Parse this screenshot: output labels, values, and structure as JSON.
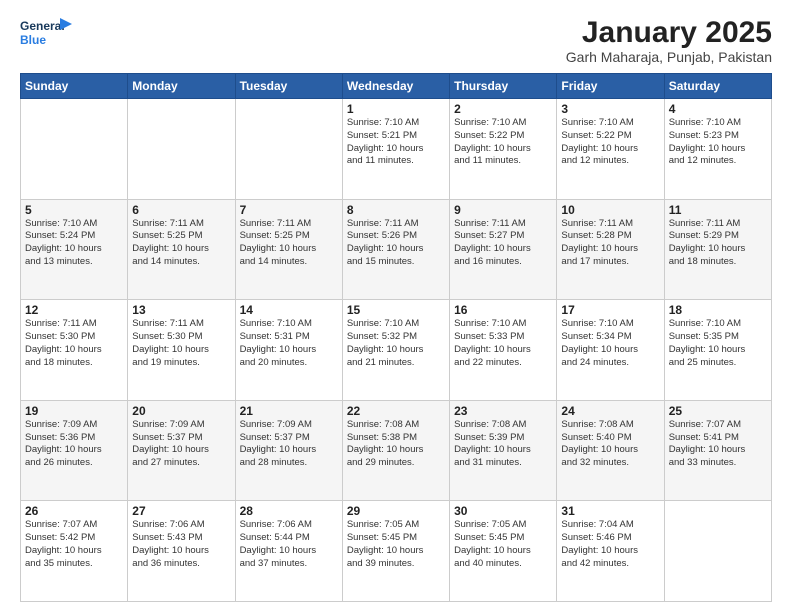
{
  "header": {
    "logo_line1": "General",
    "logo_line2": "Blue",
    "title": "January 2025",
    "subtitle": "Garh Maharaja, Punjab, Pakistan"
  },
  "columns": [
    "Sunday",
    "Monday",
    "Tuesday",
    "Wednesday",
    "Thursday",
    "Friday",
    "Saturday"
  ],
  "weeks": [
    [
      {
        "day": "",
        "info": ""
      },
      {
        "day": "",
        "info": ""
      },
      {
        "day": "",
        "info": ""
      },
      {
        "day": "1",
        "info": "Sunrise: 7:10 AM\nSunset: 5:21 PM\nDaylight: 10 hours\nand 11 minutes."
      },
      {
        "day": "2",
        "info": "Sunrise: 7:10 AM\nSunset: 5:22 PM\nDaylight: 10 hours\nand 11 minutes."
      },
      {
        "day": "3",
        "info": "Sunrise: 7:10 AM\nSunset: 5:22 PM\nDaylight: 10 hours\nand 12 minutes."
      },
      {
        "day": "4",
        "info": "Sunrise: 7:10 AM\nSunset: 5:23 PM\nDaylight: 10 hours\nand 12 minutes."
      }
    ],
    [
      {
        "day": "5",
        "info": "Sunrise: 7:10 AM\nSunset: 5:24 PM\nDaylight: 10 hours\nand 13 minutes."
      },
      {
        "day": "6",
        "info": "Sunrise: 7:11 AM\nSunset: 5:25 PM\nDaylight: 10 hours\nand 14 minutes."
      },
      {
        "day": "7",
        "info": "Sunrise: 7:11 AM\nSunset: 5:25 PM\nDaylight: 10 hours\nand 14 minutes."
      },
      {
        "day": "8",
        "info": "Sunrise: 7:11 AM\nSunset: 5:26 PM\nDaylight: 10 hours\nand 15 minutes."
      },
      {
        "day": "9",
        "info": "Sunrise: 7:11 AM\nSunset: 5:27 PM\nDaylight: 10 hours\nand 16 minutes."
      },
      {
        "day": "10",
        "info": "Sunrise: 7:11 AM\nSunset: 5:28 PM\nDaylight: 10 hours\nand 17 minutes."
      },
      {
        "day": "11",
        "info": "Sunrise: 7:11 AM\nSunset: 5:29 PM\nDaylight: 10 hours\nand 18 minutes."
      }
    ],
    [
      {
        "day": "12",
        "info": "Sunrise: 7:11 AM\nSunset: 5:30 PM\nDaylight: 10 hours\nand 18 minutes."
      },
      {
        "day": "13",
        "info": "Sunrise: 7:11 AM\nSunset: 5:30 PM\nDaylight: 10 hours\nand 19 minutes."
      },
      {
        "day": "14",
        "info": "Sunrise: 7:10 AM\nSunset: 5:31 PM\nDaylight: 10 hours\nand 20 minutes."
      },
      {
        "day": "15",
        "info": "Sunrise: 7:10 AM\nSunset: 5:32 PM\nDaylight: 10 hours\nand 21 minutes."
      },
      {
        "day": "16",
        "info": "Sunrise: 7:10 AM\nSunset: 5:33 PM\nDaylight: 10 hours\nand 22 minutes."
      },
      {
        "day": "17",
        "info": "Sunrise: 7:10 AM\nSunset: 5:34 PM\nDaylight: 10 hours\nand 24 minutes."
      },
      {
        "day": "18",
        "info": "Sunrise: 7:10 AM\nSunset: 5:35 PM\nDaylight: 10 hours\nand 25 minutes."
      }
    ],
    [
      {
        "day": "19",
        "info": "Sunrise: 7:09 AM\nSunset: 5:36 PM\nDaylight: 10 hours\nand 26 minutes."
      },
      {
        "day": "20",
        "info": "Sunrise: 7:09 AM\nSunset: 5:37 PM\nDaylight: 10 hours\nand 27 minutes."
      },
      {
        "day": "21",
        "info": "Sunrise: 7:09 AM\nSunset: 5:37 PM\nDaylight: 10 hours\nand 28 minutes."
      },
      {
        "day": "22",
        "info": "Sunrise: 7:08 AM\nSunset: 5:38 PM\nDaylight: 10 hours\nand 29 minutes."
      },
      {
        "day": "23",
        "info": "Sunrise: 7:08 AM\nSunset: 5:39 PM\nDaylight: 10 hours\nand 31 minutes."
      },
      {
        "day": "24",
        "info": "Sunrise: 7:08 AM\nSunset: 5:40 PM\nDaylight: 10 hours\nand 32 minutes."
      },
      {
        "day": "25",
        "info": "Sunrise: 7:07 AM\nSunset: 5:41 PM\nDaylight: 10 hours\nand 33 minutes."
      }
    ],
    [
      {
        "day": "26",
        "info": "Sunrise: 7:07 AM\nSunset: 5:42 PM\nDaylight: 10 hours\nand 35 minutes."
      },
      {
        "day": "27",
        "info": "Sunrise: 7:06 AM\nSunset: 5:43 PM\nDaylight: 10 hours\nand 36 minutes."
      },
      {
        "day": "28",
        "info": "Sunrise: 7:06 AM\nSunset: 5:44 PM\nDaylight: 10 hours\nand 37 minutes."
      },
      {
        "day": "29",
        "info": "Sunrise: 7:05 AM\nSunset: 5:45 PM\nDaylight: 10 hours\nand 39 minutes."
      },
      {
        "day": "30",
        "info": "Sunrise: 7:05 AM\nSunset: 5:45 PM\nDaylight: 10 hours\nand 40 minutes."
      },
      {
        "day": "31",
        "info": "Sunrise: 7:04 AM\nSunset: 5:46 PM\nDaylight: 10 hours\nand 42 minutes."
      },
      {
        "day": "",
        "info": ""
      }
    ]
  ]
}
